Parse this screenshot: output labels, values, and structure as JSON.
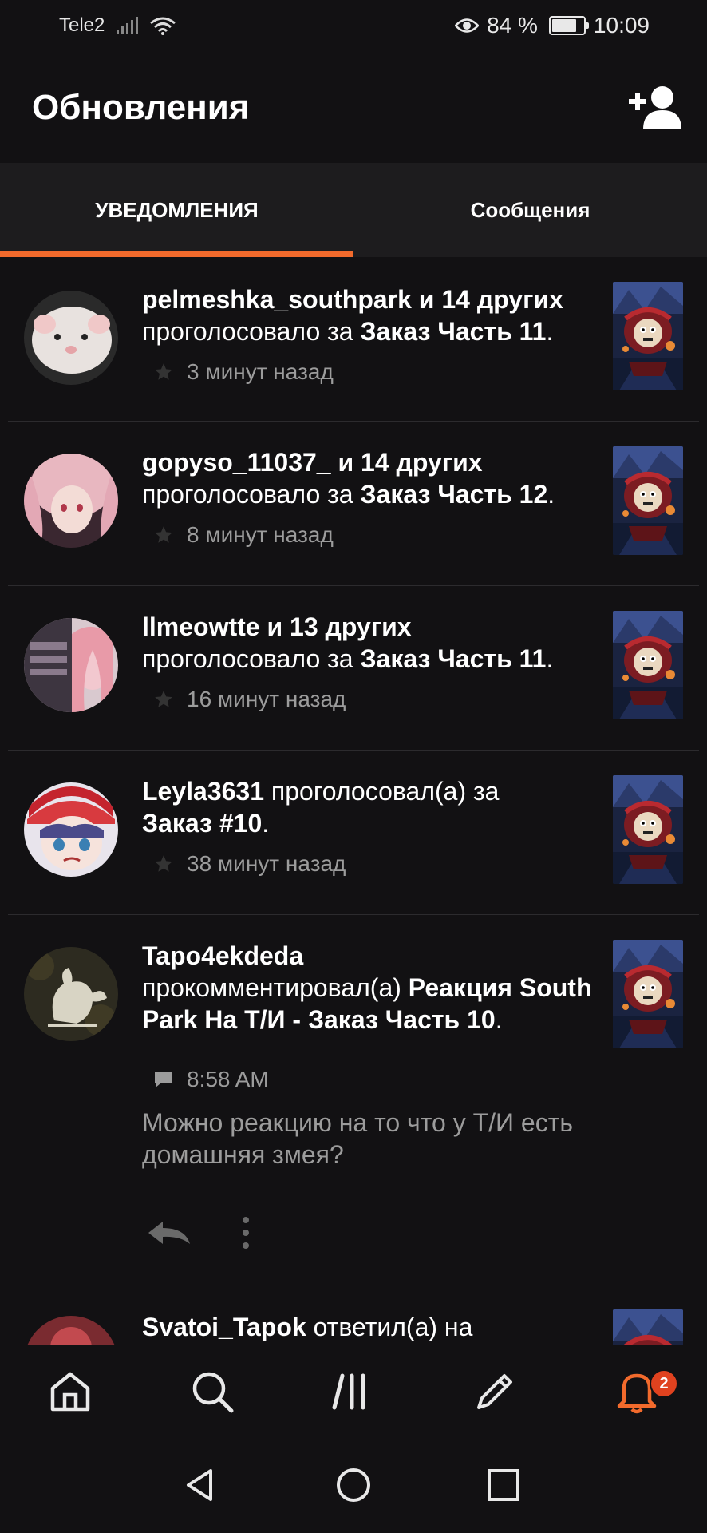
{
  "status_bar": {
    "carrier": "Tele2",
    "battery": "84 %",
    "battery_level": 0.84,
    "time": "10:09"
  },
  "header": {
    "title": "Обновления"
  },
  "tabs": [
    {
      "label": "УВЕДОМЛЕНИЯ",
      "active": true
    },
    {
      "label": "Сообщения",
      "active": false
    }
  ],
  "notifications": [
    {
      "user": "pelmeshka_southpark",
      "others": " и 14 других",
      "action": "проголосовало за",
      "target": "Заказ Часть 11",
      "end": ".",
      "time": "3 минут назад",
      "icon": "star-icon"
    },
    {
      "user": "gopyso_11037_",
      "others": " и 14 других",
      "action": "проголосовало за",
      "target": "Заказ Часть 12",
      "end": ".",
      "time": "8 минут назад",
      "icon": "star-icon"
    },
    {
      "user": "llmeowtte",
      "others": " и 13 других",
      "action": "проголосовало за",
      "target": "Заказ Часть 11",
      "end": ".",
      "time": "16 минут назад",
      "icon": "star-icon"
    },
    {
      "user": "Leyla3631",
      "action": " проголосовал(а) за",
      "target": "Заказ #10",
      "end": ".",
      "time": "38 минут назад",
      "icon": "star-icon"
    },
    {
      "user": "Tapo4ekdeda",
      "action": "прокомментировал(а)",
      "target": "Реакция South Park На Т/И - Заказ Часть 10",
      "end": ".",
      "time": "8:58 AM",
      "icon": "comment-icon",
      "comment": "Можно реакцию на то что у Т/И есть домашняя змея?"
    },
    {
      "user": "Svatoi_Tapok",
      "action": " ответил(а) на"
    }
  ],
  "bottom_nav": {
    "items": [
      "home-icon",
      "search-icon",
      "library-icon",
      "write-icon",
      "notifications-bell-icon"
    ],
    "active": "notifications-bell-icon",
    "badge": "2"
  },
  "colors": {
    "accent": "#f26a2c",
    "background": "#121113",
    "tabs_background": "#1d1c1e",
    "muted_text": "#9c9c9c",
    "badge": "#e0421f"
  }
}
